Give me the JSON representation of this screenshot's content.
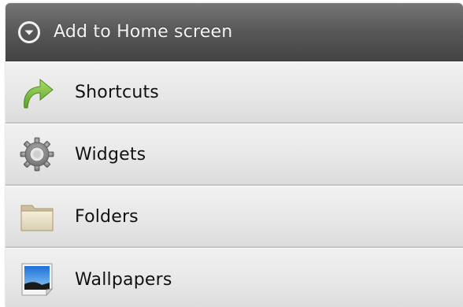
{
  "dialog": {
    "title": "Add to Home screen",
    "title_icon": "chevron-down-circle-icon"
  },
  "items": [
    {
      "label": "Shortcuts",
      "icon": "shortcut-arrow-icon"
    },
    {
      "label": "Widgets",
      "icon": "gear-icon"
    },
    {
      "label": "Folders",
      "icon": "folder-icon"
    },
    {
      "label": "Wallpapers",
      "icon": "wallpaper-icon"
    }
  ],
  "colors": {
    "title_bar": "#5a5a5a",
    "title_text": "#f4f4f4",
    "list_bg": "#e7e7e7",
    "shortcut_green": "#7cc043"
  }
}
